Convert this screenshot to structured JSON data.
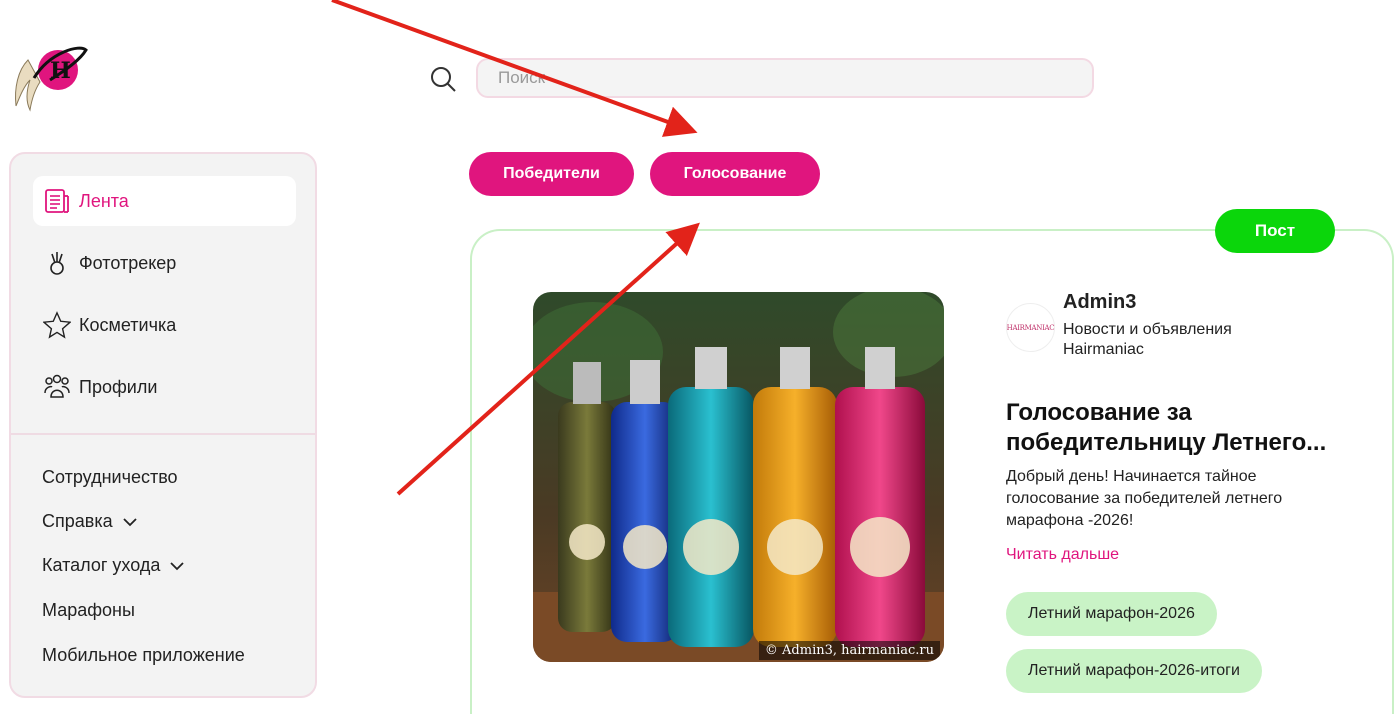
{
  "brand": {
    "accent": "#e0157e",
    "post_green": "#0bd60b",
    "tag_green": "#c9f3c6"
  },
  "logo": {
    "icon": "hairmaniac-logo-icon"
  },
  "search": {
    "placeholder": "Поиск",
    "icon": "search-icon"
  },
  "filters": {
    "winners": "Победители",
    "voting": "Голосование"
  },
  "sidebar": {
    "nav": [
      {
        "label": "Лента",
        "icon": "feed-icon",
        "active": true
      },
      {
        "label": "Фототрекер",
        "icon": "phototracker-icon",
        "active": false
      },
      {
        "label": "Косметичка",
        "icon": "star-icon",
        "active": false
      },
      {
        "label": "Профили",
        "icon": "profiles-icon",
        "active": false
      }
    ],
    "links": [
      {
        "label": "Сотрудничество",
        "chevron": false
      },
      {
        "label": "Справка",
        "chevron": true
      },
      {
        "label": "Каталог ухода",
        "chevron": true
      },
      {
        "label": "Марафоны",
        "chevron": false
      },
      {
        "label": "Мобильное приложение",
        "chevron": false
      }
    ]
  },
  "post": {
    "badge": "Пост",
    "image_watermark": "© Admin3, hairmaniac.ru",
    "author_avatar_text": "HAIRMANIAC",
    "author": "Admin3",
    "author_subtitle": "Новости и объявления Hairmaniac",
    "title": "Голосование за победительницу Летнего...",
    "excerpt": "Добрый день! Начинается тайное голосование за победителей летнего марафона -2026!",
    "read_more": "Читать дальше",
    "tags": [
      "Летний марафон-2026",
      "Летний марафон-2026-итоги"
    ]
  }
}
